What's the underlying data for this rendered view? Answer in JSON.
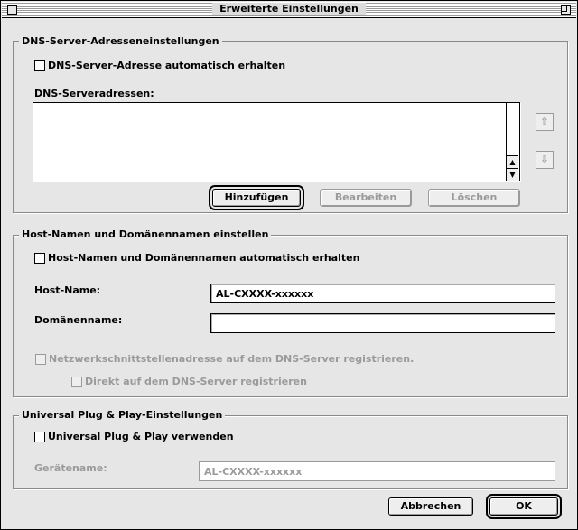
{
  "window": {
    "title": "Erweiterte Einstellungen"
  },
  "dns": {
    "group_label": "DNS-Server-Adresseneinstellungen",
    "auto_checkbox_label": "DNS-Server-Adresse automatisch erhalten",
    "list_label": "DNS-Serveradressen:",
    "add_button": "Hinzufügen",
    "edit_button": "Bearbeiten",
    "delete_button": "Löschen"
  },
  "host": {
    "group_label": "Host-Namen und Domänennamen einstellen",
    "auto_checkbox_label": "Host-Namen und Domänennamen automatisch erhalten",
    "hostname_label": "Host-Name:",
    "hostname_value": "AL-CXXXX-xxxxxx",
    "domain_label": "Domänenname:",
    "domain_value": "",
    "register_label": "Netzwerkschnittstellenadresse auf dem DNS-Server registrieren.",
    "direct_label": "Direkt auf dem DNS-Server registrieren"
  },
  "upnp": {
    "group_label": "Universal Plug & Play-Einstellungen",
    "use_checkbox_label": "Universal Plug & Play verwenden",
    "device_label": "Gerätename:",
    "device_value": "AL-CXXXX-xxxxxx"
  },
  "footer": {
    "cancel_button": "Abbrechen",
    "ok_button": "OK"
  }
}
